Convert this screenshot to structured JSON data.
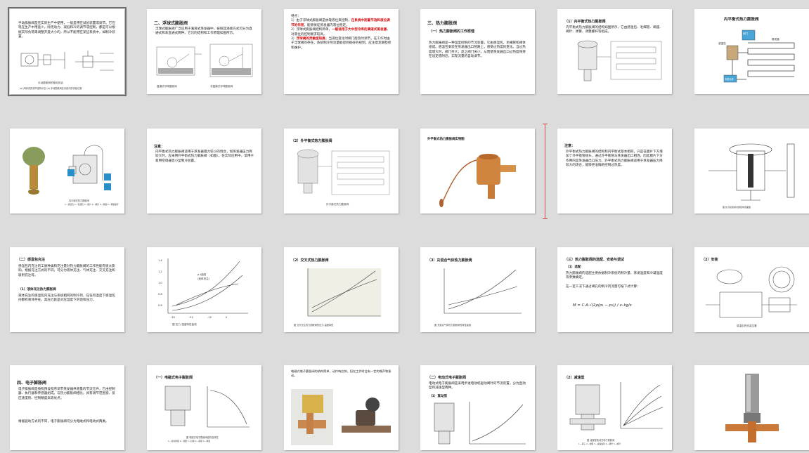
{
  "slides": [
    {
      "text": "手动膨胀阀是在实际生产中使用，一般是用在试验装置或调节。它在现在生产中用途少。除无动力、减低和冷的调节或控制，都是可以根据实际负荷来调整开度大小的，所以不能用在某些系统中，如制冷装置。",
      "caption": "手动膨胀阀的使用场合",
      "caption2": "(a) 阀体内的调节结构示意 (b) 手动膨胀阀在系统中的安装位置"
    },
    {
      "title": "二、浮球式膨胀阀",
      "text": "浮球式膨胀阀广泛应用于满液式蒸发器中，按照其连接方式可分为直通式和非直通式两种。它们的结构和工作原理如图所示。",
      "caption": "直通式浮球膨胀阀",
      "caption2": "非直通式浮球膨胀阀"
    },
    {
      "text": "特点：",
      "text2": "1）由于浮球式膨胀阀是依靠液位来控制，",
      "hl1": "在系统中起着节流和液位调节的作用",
      "text3": "，能够保证蒸发器内液位稳定。",
      "text4": "2）浮球式膨胀阀结构简单，",
      "hl2": "一般适用于大中型冷库的满液式蒸发器",
      "text5": "，对液位的控制要求较高。",
      "text6": "3）",
      "hl3": "浮球阀的灵敏度较高",
      "text7": "，当液位变化时阀门能及时调节。在工作时由于浮球阀的存在，系统制冷剂流量能得到很好的控制，应注意定期检修和维护。"
    },
    {
      "title": "三、热力膨胀阀",
      "subtitle": "（一）热力膨胀阀的工作原理",
      "text": "热力膨胀阀是一种温度控制的节流装置，它由感温包、毛细管和阀体组成。感温包安装在蒸发器出口管路上，感受过热度的变化。当过热度增大时，阀门开大；反之阀门关小，从而使蒸发器出口过热度保持在设定值附近，实现流量的自动调节。"
    },
    {
      "title": "（1）内平衡式热力膨胀阀",
      "text": "内平衡式热力膨胀阀的结构如图所示，它由感温包、毛细管、阀座、阀针、弹簧、调整螺杆等组成。"
    },
    {
      "title": "内平衡式热力膨胀阀",
      "label1": "阀门",
      "label2": "感温包",
      "label3": "蒸发器",
      "label4": "传感元件"
    },
    {
      "caption": "内平衡式热力膨胀阀",
      "caption2": "1—感温包 2—毛细管 3—膜片 4—阀针 5—弹簧 6—调整螺杆"
    },
    {
      "title": "注意：",
      "text": "内平衡式热力膨胀阀适用于蒸发器阻力较小的场合，如蒸发器压力降较大时，应采用外平衡式热力膨胀阀（如图）。在实际应用中，常用于家用空调器等小型制冷装置。"
    },
    {
      "title": "（2）外平衡式热力膨胀阀",
      "caption": "外平衡式热力膨胀阀"
    },
    {
      "title": "外平衡式热力膨胀阀实物图"
    },
    {
      "title": "注意：",
      "text": "外平衡式热力膨胀阀的结构和内平衡式基本相同，只是在膜片下方增加了外平衡管接头，通过外平衡管与蒸发器出口相连，因此膜片下方作用的是蒸发器出口压力。外平衡式热力膨胀阀适用于蒸发器压力降较大的场合，能够更准确地控制过热度。"
    },
    {
      "caption": "图 热力膨胀阀内部结构剖面图"
    },
    {
      "title": "（二）感温包充注",
      "text": "感温包内充注的工质种类和充注量对热力膨胀阀的工作性能有很大影响。根据充注方式的不同，可分为液体充注、气体充注、交叉充注和吸附充注等。",
      "subtitle": "（1）液体充注热力膨胀阀",
      "text2": "液体充注的感温包内充注与系统相同的制冷剂，在任何温度下感温包内都有液体存在，其压力就是对应温度下的饱和压力。"
    },
    {
      "caption": "图 压力-温度特性曲线",
      "label1": "p-t曲线",
      "label2": "(液体充注)"
    },
    {
      "title": "（2）交叉式热力膨胀阀",
      "caption": "图 交叉充注热力膨胀阀的压力-温度特性"
    },
    {
      "title": "（3）充混合气体热力膨胀阀",
      "caption": "图 充混合气体热力膨胀阀的特性曲线"
    },
    {
      "title": "（三）热力膨胀阀的选配、安装与调试",
      "subtitle": "（1）选配",
      "text": "热力膨胀阀的选配主要依据制冷系统的制冷量、蒸发温度和冷凝温度等参数确定。",
      "text2": "在一定工况下通过阀孔的制冷剂流量可按下式计算：",
      "formula": "M = C·A·√(2ρ(p₁ − p₂)) / vᵢ   kg/s"
    },
    {
      "title": "（2）安装",
      "caption": "感温包的安装位置"
    },
    {
      "title": "四、电子膨胀阀",
      "text": "电子膨胀阀是按照预设程序调节蒸发器供液量的节流元件，它由控制器、执行器和传感器组成。与热力膨胀阀相比，具有调节范围宽、反应速度快、控制精度高等优点。",
      "text2": "根据驱动方式的不同，电子膨胀阀可分为电磁式和电动式两类。"
    },
    {
      "title": "（一）电磁式电子膨胀阀",
      "caption": "图 电磁式电子膨胀阀结构及特性",
      "caption2": "1—柱塞弹簧 2—线圈 3—柱塞 4—阀座 5—弹簧"
    },
    {
      "text": "电磁式电子膨胀阀的结构简单，动作响应快，但在工作时会有一定的噪声和振动。"
    },
    {
      "title": "（二）电动式电子膨胀阀",
      "text": "电动式电子膨胀阀是采用步进电动机驱动阀针的节流装置，分为直动型和减速型两种。",
      "subtitle": "（1）直动型"
    },
    {
      "title": "（2）减速型",
      "caption": "图 减速型电动式电子膨胀阀",
      "caption2": "1—转子 2—线圈 3—减速齿轮 4—阀杆 5—阀针"
    },
    {}
  ]
}
